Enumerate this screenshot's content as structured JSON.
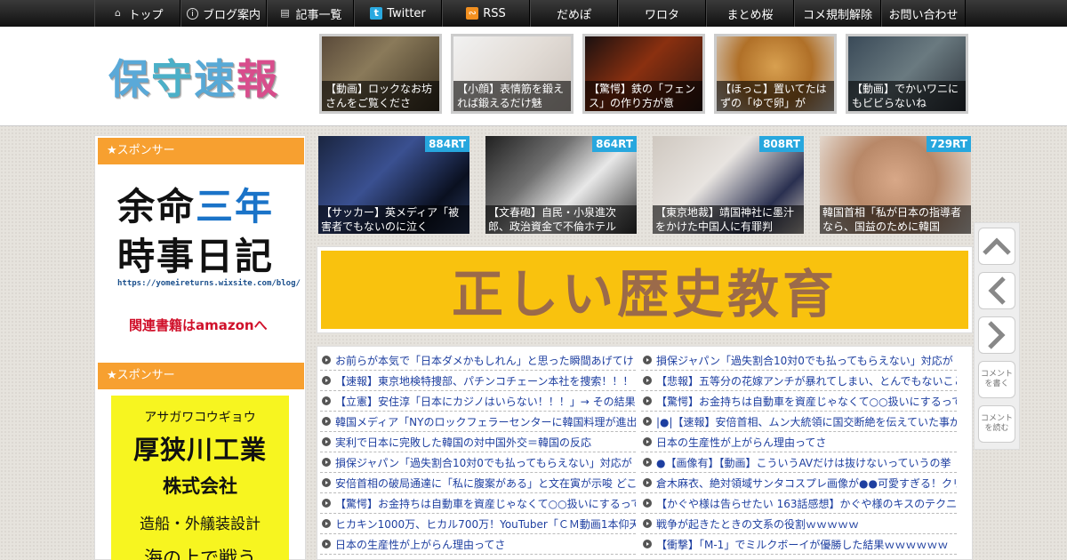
{
  "nav": [
    {
      "label": "トップ",
      "icon": "home-icon"
    },
    {
      "label": "ブログ案内",
      "icon": "info-icon"
    },
    {
      "label": "記事一覧",
      "icon": "list-icon"
    },
    {
      "label": "Twitter",
      "icon": "twitter-icon"
    },
    {
      "label": "RSS",
      "icon": "rss-icon"
    },
    {
      "label": "だめぽ"
    },
    {
      "label": "ワロタ"
    },
    {
      "label": "まとめ桜"
    },
    {
      "label": "コメ規制解除"
    },
    {
      "label": "お問い合わせ"
    }
  ],
  "logo": {
    "chars": [
      "保",
      "守",
      "速",
      "報"
    ]
  },
  "header_thumbs": [
    "【動画】ロックなお坊さんをご覧くださ",
    "【小顔】表情筋を鍛えれば鍛えるだけ魅",
    "【驚愕】鉄の「フェンス」の作り方が意",
    "【ほっこ】置いてたはずの「ゆで卵」が",
    "【動画】でかいワニにもビビらないね"
  ],
  "sidebar": {
    "sponsor_label": "★スポンサー",
    "ad1": {
      "line1a": "余命",
      "line1b": "三年",
      "line2": "時事日記",
      "url": "https://yomeireturns.wixsite.com/blog/",
      "amazon": "関連書籍はamazonへ"
    },
    "ad2": {
      "kana": "アサガワコウギョウ",
      "name": "厚狭川工業",
      "corp": "株式会社",
      "biz": "造船・外艤装設計",
      "more": "海の上で戦う"
    }
  },
  "ranking": [
    {
      "rt": "884RT",
      "caption": "【サッカー】英メディア「被害者でもないのに泣く"
    },
    {
      "rt": "864RT",
      "caption": "【文春砲】自民・小泉進次郎、政治資金で不倫ホテル"
    },
    {
      "rt": "808RT",
      "caption": "【東京地裁】靖国神社に墨汁をかけた中国人に有罪判"
    },
    {
      "rt": "729RT",
      "caption": "韓国首相「私が日本の指導者なら、国益のために韓国"
    }
  ],
  "banner": {
    "text": "正しい歴史教育"
  },
  "list_left": [
    "お前らが本気で「日本ダメかもしれん」と思った瞬間あげてけ",
    "【速報】東京地検特捜部、パチンコチェーン本社を捜索！！！",
    "【立憲】安住淳「日本にカジノはいらない！！！」→ その結果",
    "韓国メディア「NYのロックフェラーセンターに韓国料理が進出",
    "実利で日本に完敗した韓国の対中国外交＝韓国の反応",
    "損保ジャパン「過失割合10対0でも払ってもらえない」対応が",
    "安倍首相の破局通達に「私に腹案がある」と文在寅が示唆 どこ",
    "【驚愕】お金持ちは自動車を資産じゃなくて○○扱いにするって",
    "ヒカキン1000万、ヒカル700万！YouTuber「ＣＭ動画1本仰天お",
    "日本の生産性が上がらん理由ってさ"
  ],
  "list_right": [
    "損保ジャパン「過失割合10対0でも払ってもらえない」対応が",
    "【悲報】五等分の花嫁アンチが暴れてしまい、とんでもないこと",
    "【驚愕】お金持ちは自動車を資産じゃなくて○○扱いにするって",
    "|●|【速報】安倍首相、ムン大統領に国交断絶を伝えていた事が",
    "日本の生産性が上がらん理由ってさ",
    "●【画像有】【動画】こういうAVだけは抜けないっていうの挙",
    "倉木麻衣、絶対領域サンタコスプレ画像が●●可愛すぎる！クリ",
    "【かぐや様は告らせたい 163話感想】かぐや様のキスのテクニ",
    "戦争が起きたときの文系の役割ｗｗｗｗｗ",
    "【衝撃】「M-1」でミルクボーイが優勝した結果ｗｗｗｗｗｗ"
  ],
  "side_buttons": {
    "write": "コメントを書く",
    "read": "コメントを読む"
  }
}
